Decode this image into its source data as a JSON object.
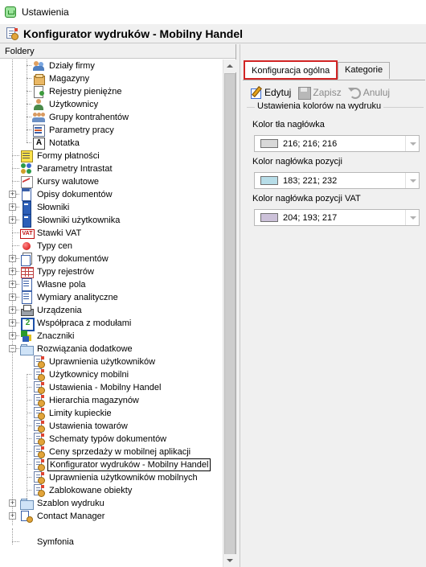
{
  "window": {
    "title": "Ustawienia"
  },
  "header": {
    "title": "Konfigurator wydruków - Mobilny Handel"
  },
  "folders": {
    "title": "Foldery",
    "items": [
      {
        "label": "Działy firmy",
        "icon": "departments-icon"
      },
      {
        "label": "Magazyny",
        "icon": "warehouse-icon"
      },
      {
        "label": "Rejestry pieniężne",
        "icon": "cash-register-icon"
      },
      {
        "label": "Użytkownicy",
        "icon": "user-icon"
      },
      {
        "label": "Grupy kontrahentów",
        "icon": "contractor-groups-icon"
      },
      {
        "label": "Parametry pracy",
        "icon": "parameters-icon"
      },
      {
        "label": "Notatka",
        "icon": "note-icon"
      },
      {
        "label": "Formy płatności",
        "icon": "payment-forms-icon"
      },
      {
        "label": "Parametry Intrastat",
        "icon": "intrastat-icon"
      },
      {
        "label": "Kursy walutowe",
        "icon": "currency-chart-icon"
      },
      {
        "label": "Opisy dokumentów",
        "icon": "document-icon"
      },
      {
        "label": "Słowniki",
        "icon": "dictionary-icon"
      },
      {
        "label": "Słowniki użytkownika",
        "icon": "user-dictionary-icon"
      },
      {
        "label": "Stawki VAT",
        "icon": "vat-icon"
      },
      {
        "label": "Typy cen",
        "icon": "price-types-icon"
      },
      {
        "label": "Typy dokumentów",
        "icon": "document-types-icon"
      },
      {
        "label": "Typy rejestrów",
        "icon": "register-types-icon"
      },
      {
        "label": "Własne pola",
        "icon": "custom-fields-icon"
      },
      {
        "label": "Wymiary analityczne",
        "icon": "analytic-dimensions-icon"
      },
      {
        "label": "Urządzenia",
        "icon": "printer-icon"
      },
      {
        "label": "Współpraca z modułami",
        "icon": "modules-icon"
      },
      {
        "label": "Znaczniki",
        "icon": "markers-icon"
      },
      {
        "label": "Rozwiązania dodatkowe",
        "icon": "open-folder-icon"
      },
      {
        "label": "Uprawnienia użytkowników",
        "icon": "config-icon"
      },
      {
        "label": "Użytkownicy mobilni",
        "icon": "config-icon"
      },
      {
        "label": "Ustawienia - Mobilny Handel",
        "icon": "config-icon"
      },
      {
        "label": "Hierarchia magazynów",
        "icon": "config-icon"
      },
      {
        "label": "Limity kupieckie",
        "icon": "config-icon"
      },
      {
        "label": "Ustawienia towarów",
        "icon": "config-icon"
      },
      {
        "label": "Schematy typów dokumentów",
        "icon": "config-icon"
      },
      {
        "label": "Ceny sprzedaży w mobilnej aplikacji",
        "icon": "config-icon"
      },
      {
        "label": "Konfigurator wydruków - Mobilny Handel",
        "icon": "config-icon"
      },
      {
        "label": "Uprawnienia użytkowników mobilnych",
        "icon": "config-icon"
      },
      {
        "label": "Zablokowane obiekty",
        "icon": "config-icon"
      },
      {
        "label": "Szablon wydruku",
        "icon": "folder-icon"
      },
      {
        "label": "Contact Manager",
        "icon": "contact-manager-icon"
      },
      {
        "label": "Symfonia",
        "icon": "symfonia-icon"
      }
    ]
  },
  "tabs": [
    {
      "label": "Konfiguracja ogólna"
    },
    {
      "label": "Kategorie"
    }
  ],
  "toolbar": {
    "edit": "Edytuj",
    "save": "Zapisz",
    "cancel": "Anuluj"
  },
  "colors_group": {
    "legend": "Ustawienia kolorów na wydruku",
    "fields": [
      {
        "label": "Kolor tła nagłówka",
        "value": "216; 216; 216",
        "swatch": "#d8d8d8"
      },
      {
        "label": "Kolor nagłówka pozycji",
        "value": "183; 221; 232",
        "swatch": "#b7dde8"
      },
      {
        "label": "Kolor nagłówka pozycji VAT",
        "value": "204; 193; 217",
        "swatch": "#ccc1d9"
      }
    ]
  }
}
